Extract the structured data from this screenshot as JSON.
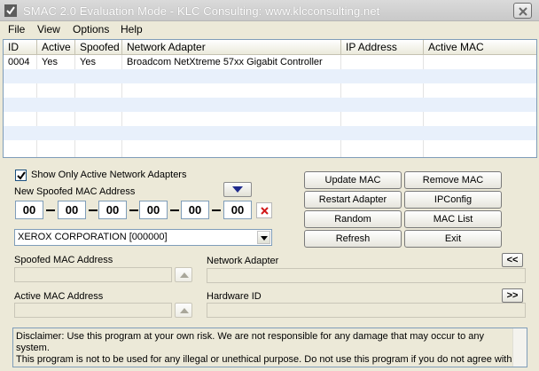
{
  "window": {
    "title": "SMAC 2.0  Evaluation Mode  -  KLC Consulting:  www.klcconsulting.net"
  },
  "menu": [
    {
      "label": "File"
    },
    {
      "label": "View"
    },
    {
      "label": "Options"
    },
    {
      "label": "Help"
    }
  ],
  "adapter_table": {
    "columns": [
      "ID",
      "Active",
      "Spoofed",
      "Network Adapter",
      "IP Address",
      "Active MAC"
    ],
    "rows": [
      {
        "id": "0004",
        "active": "Yes",
        "spoofed": "Yes",
        "network_adapter": "Broadcom NetXtreme 57xx Gigabit Controller",
        "ip_address": "",
        "active_mac": ""
      }
    ]
  },
  "options": {
    "show_only_active_label": "Show Only Active Network Adapters",
    "show_only_active_checked": true
  },
  "new_mac": {
    "label": "New Spoofed MAC Address",
    "octets": [
      "00",
      "00",
      "00",
      "00",
      "00",
      "00"
    ]
  },
  "vendor_select": {
    "value": "XEROX CORPORATION [000000]"
  },
  "buttons": {
    "update_mac": "Update MAC",
    "remove_mac": "Remove MAC",
    "restart_adapter": "Restart Adapter",
    "ipconfig": "IPConfig",
    "random": "Random",
    "mac_list": "MAC List",
    "refresh": "Refresh",
    "exit": "Exit",
    "collapse": "<<",
    "expand": ">>"
  },
  "fields": {
    "spoofed_mac_label": "Spoofed MAC Address",
    "spoofed_mac_value": "",
    "network_adapter_label": "Network Adapter",
    "network_adapter_value": "",
    "active_mac_label": "Active MAC Address",
    "active_mac_value": "",
    "hardware_id_label": "Hardware ID",
    "hardware_id_value": ""
  },
  "disclaimer": {
    "line1": "Disclaimer: Use this program at your own risk.  We are not responsible for any damage that may occur to any system.",
    "line2": "This program is not to be used for any illegal or unethical purpose.  Do not use this program if you do not agree with"
  },
  "colors": {
    "window_bg": "#ece9d8",
    "grid_border": "#7f9db9",
    "alt_row": "#e8f0fb",
    "arrow_blue": "#1f2a8c",
    "clear_red": "#d11a1a"
  }
}
